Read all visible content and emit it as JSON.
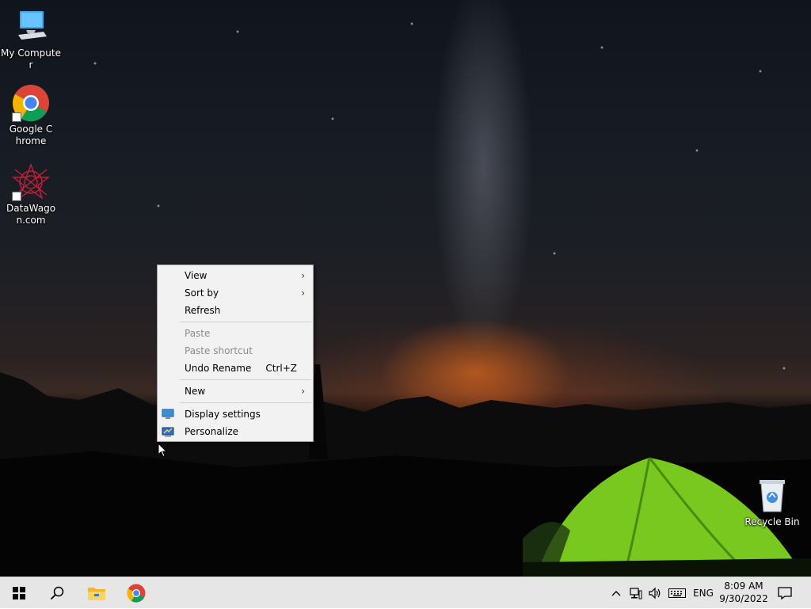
{
  "desktop": {
    "icons": [
      {
        "label": "My Computer",
        "icon": "computer-icon"
      },
      {
        "label": "Google Chrome",
        "icon": "chrome-icon"
      },
      {
        "label": "DataWagon.com",
        "icon": "datawagon-icon"
      },
      {
        "label": "Recycle Bin",
        "icon": "recycle-bin-icon"
      }
    ]
  },
  "context_menu": {
    "items": [
      {
        "label": "View",
        "has_submenu": true,
        "enabled": true
      },
      {
        "label": "Sort by",
        "has_submenu": true,
        "enabled": true
      },
      {
        "label": "Refresh",
        "enabled": true
      },
      {
        "label": "Paste",
        "enabled": false
      },
      {
        "label": "Paste shortcut",
        "enabled": false
      },
      {
        "label": "Undo Rename",
        "shortcut": "Ctrl+Z",
        "enabled": true
      },
      {
        "label": "New",
        "has_submenu": true,
        "enabled": true
      },
      {
        "label": "Display settings",
        "icon": "display-settings-icon",
        "enabled": true
      },
      {
        "label": "Personalize",
        "icon": "personalize-icon",
        "enabled": true
      }
    ]
  },
  "taskbar": {
    "buttons": [
      "start-icon",
      "search-icon",
      "file-explorer-icon",
      "chrome-icon"
    ],
    "tray": {
      "language": "ENG",
      "time": "8:09 AM",
      "date": "9/30/2022"
    }
  },
  "colors": {
    "taskbar_bg": "#e6e6e6",
    "menu_bg": "#f2f2f2",
    "tent_green": "#7ed321"
  }
}
